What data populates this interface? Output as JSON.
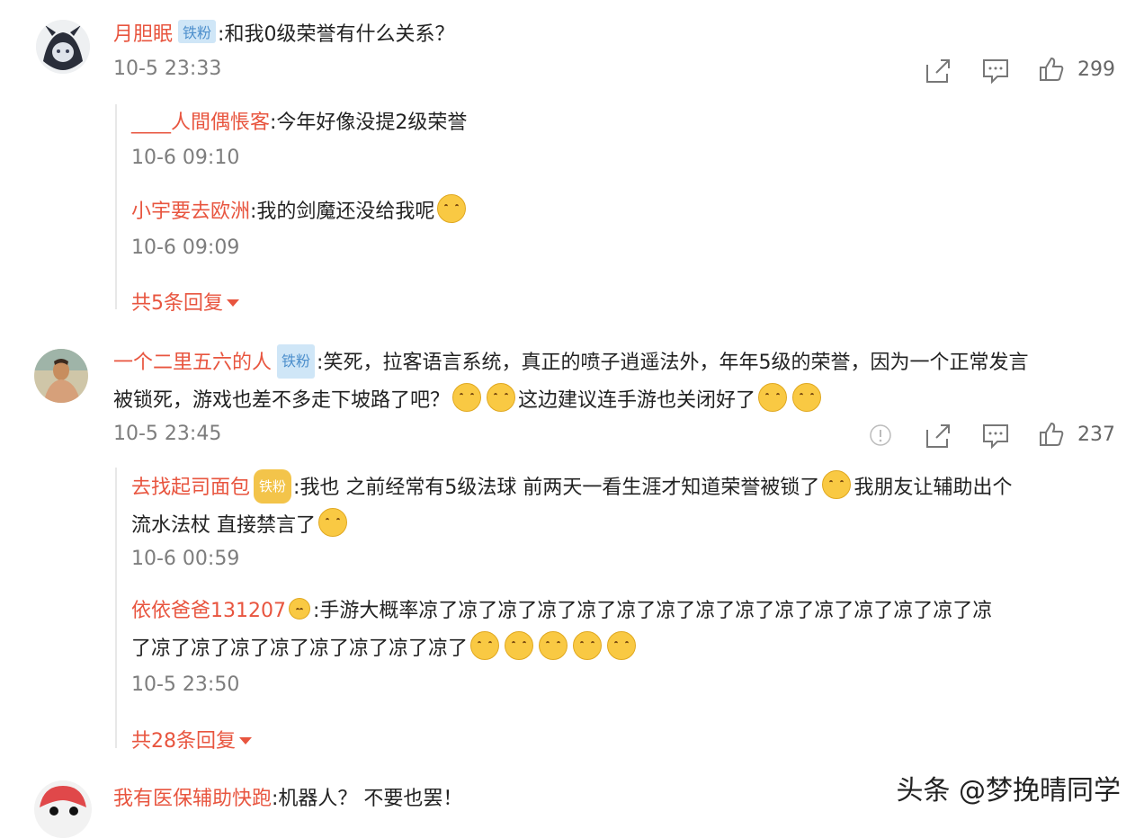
{
  "comments": [
    {
      "user": "月胆眠",
      "badge": "铁粉",
      "text": ":和我0级荣誉有什么关系？",
      "time": "10-5 23:33",
      "likes": "299",
      "replies": [
        {
          "user": "____人間偶悵客",
          "text": ":今年好像没提2级荣誉",
          "time": "10-6 09:10"
        },
        {
          "user": "小宇要去欧洲",
          "text": ":我的剑魔还没给我呢",
          "time": "10-6 09:09"
        }
      ],
      "more": "共5条回复"
    },
    {
      "user": "一个二里五六的人",
      "badge": "铁粉",
      "text_line1": ":笑死，拉客语言系统，真正的喷子逍遥法外，年年5级的荣誉，因为一个正常发言",
      "text_line2_a": "被锁死，游戏也差不多走下坡路了吧？",
      "text_line2_b": "这边建议连手游也关闭好了",
      "time": "10-5 23:45",
      "likes": "237",
      "replies": [
        {
          "user": "去找起司面包",
          "badge": "铁粉",
          "text_line1_a": ":我也 之前经常有5级法球 前两天一看生涯才知道荣誉被锁了",
          "text_line1_b": "我朋友让辅助出个",
          "text_line2": "流水法杖 直接禁言了",
          "time": "10-6 00:59"
        },
        {
          "user": "依依爸爸131207",
          "text_line1": ":手游大概率凉了凉了凉了凉了凉了凉了凉了凉了凉了凉了凉了凉了凉了凉了凉",
          "text_line2": "了凉了凉了凉了凉了凉了凉了凉了凉了",
          "time": "10-5 23:50"
        }
      ],
      "more": "共28条回复"
    },
    {
      "user": "我有医保辅助快跑",
      "text": ":机器人？ 不要也罢！"
    }
  ],
  "watermark": "头条 @梦挽晴同学",
  "icons": [
    "share-icon",
    "comment-icon",
    "like-icon",
    "report-icon"
  ],
  "colors": {
    "username": "#e8553f",
    "badge_bg": "#cfe6f7",
    "badge_text": "#4d8fcc",
    "time": "#7d7d7d"
  }
}
